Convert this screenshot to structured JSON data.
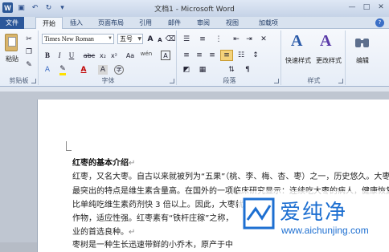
{
  "window": {
    "title": "文档1 - Microsoft Word"
  },
  "tabs": [
    "文件",
    "开始",
    "插入",
    "页面布局",
    "引用",
    "邮件",
    "审阅",
    "视图",
    "加载项"
  ],
  "font": {
    "name": "Times New Roman",
    "size": "五号",
    "grow": "A",
    "shrink": "A",
    "aa": "Aa",
    "wen": "wén",
    "A": "A"
  },
  "format_buttons": {
    "bold": "B",
    "italic": "I",
    "underline": "U",
    "strike": "abc",
    "sub": "x₂",
    "sup": "x²"
  },
  "groups": {
    "clipboard": "剪贴板",
    "font": "字体",
    "paragraph": "段落",
    "styles": "样式",
    "editing": "编辑"
  },
  "clipboard": {
    "paste": "粘贴"
  },
  "styles": {
    "quick": "快速样式",
    "change": "更改样式"
  },
  "doc": {
    "heading": "红枣的基本介绍",
    "lines": [
      "红枣，又名大枣。自古以来就被列为“五果”（桃、李、梅、杏、枣）之一，历史悠久。大枣",
      "最突出的特点是维生素含量高。在国外的一项临床研究显示：连续吃大枣的病人，健康恢复",
      "比单纯吃维生素药剂快 3 倍以上。因此，大枣就",
      "作物，适应性强。红枣素有“铁杆庄稼”之称，",
      "业的首选良种。",
      "枣树是一种生长迅速带鲜的小乔木，原产于中"
    ]
  },
  "watermark": {
    "text": "爱纯净",
    "url": "www.aichunjing.com"
  },
  "colors": {
    "file_tab": "#2b579a",
    "watermark": "#1d6fd1"
  }
}
